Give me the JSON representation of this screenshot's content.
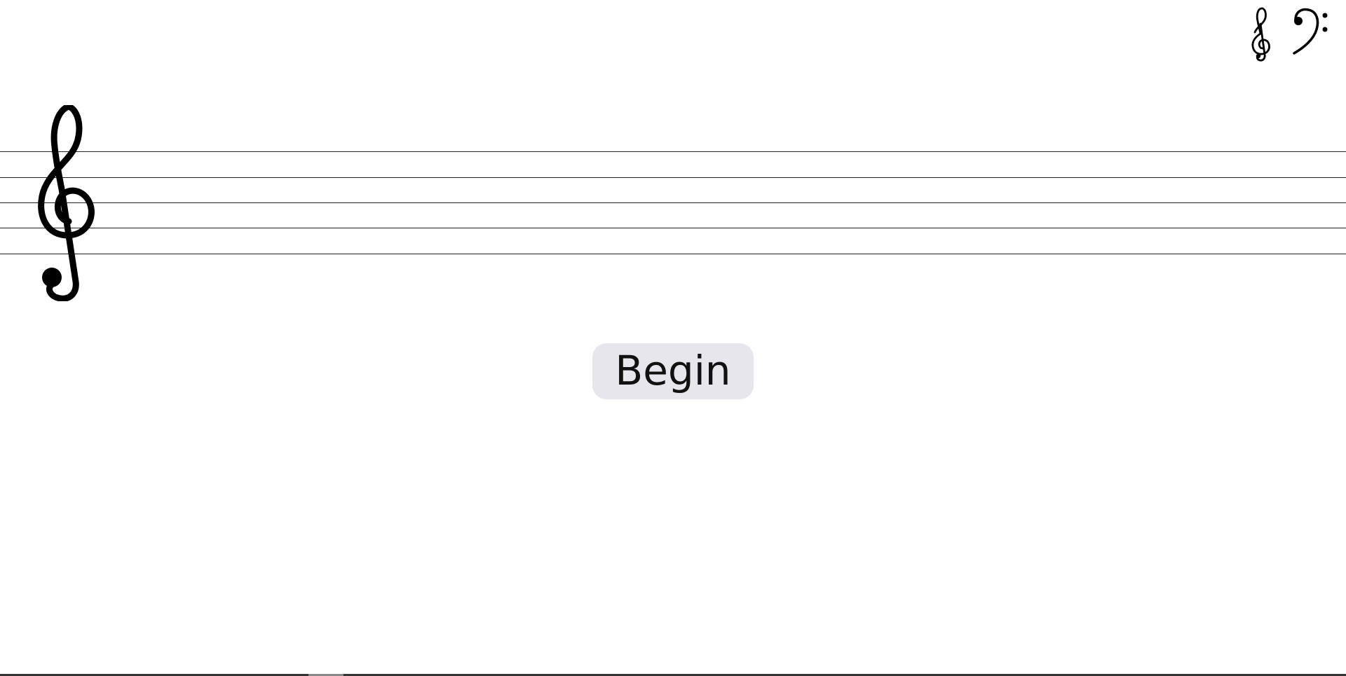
{
  "header": {
    "clef_options": [
      {
        "name": "treble-clef",
        "glyph": "𝄞"
      },
      {
        "name": "bass-clef",
        "glyph": "𝄢"
      }
    ]
  },
  "staff": {
    "clef": "treble-clef",
    "line_count": 5
  },
  "main": {
    "begin_label": "Begin"
  },
  "colors": {
    "staff_line": "#222222",
    "button_bg": "#e7e6ec",
    "background": "#ffffff"
  }
}
